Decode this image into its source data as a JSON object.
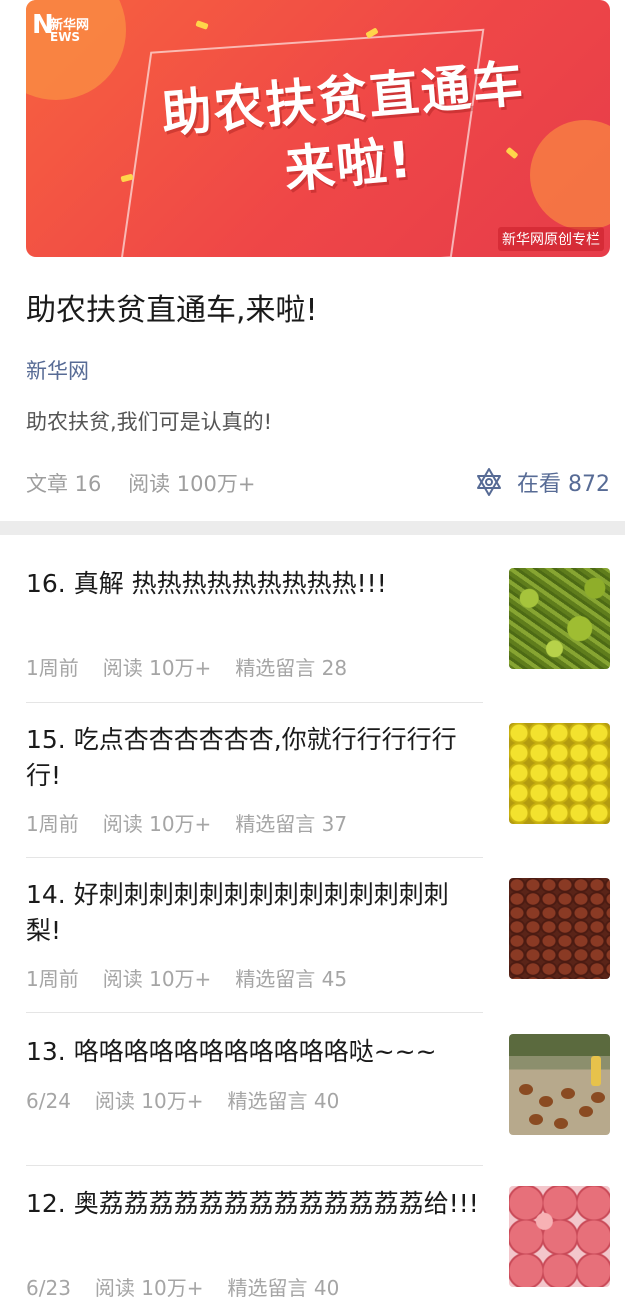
{
  "banner": {
    "logo_text": "新华网",
    "logo_n": "N",
    "logo_ws": "EWS",
    "headline_line1": "助农扶贫直通车",
    "headline_line2": "来啦!",
    "corner_tag": "新华网原创专栏"
  },
  "album": {
    "title": "助农扶贫直通车,来啦!",
    "source": "新华网",
    "description": "助农扶贫,我们可是认真的!",
    "articles_count": "文章 16",
    "reads": "阅读 100万+",
    "watching": "在看 872"
  },
  "articles": [
    {
      "title": "16. 真解 热热热热热热热热热!!!",
      "date": "1周前",
      "reads": "阅读 10万+",
      "comments": "精选留言 28",
      "thumb": "moss-greens"
    },
    {
      "title": "15. 吃点杏杏杏杏杏杏,你就行行行行行行!",
      "date": "1周前",
      "reads": "阅读 10万+",
      "comments": "精选留言 37",
      "thumb": "yellow-apricots"
    },
    {
      "title": "14. 好刺刺刺刺刺刺刺刺刺刺刺刺刺刺梨!",
      "date": "1周前",
      "reads": "阅读 10万+",
      "comments": "精选留言 45",
      "thumb": "dried-prickly-pears"
    },
    {
      "title": "13. 咯咯咯咯咯咯咯咯咯咯咯哒~~~",
      "date": "6/24",
      "reads": "阅读 10万+",
      "comments": "精选留言 40",
      "thumb": "chicken-farm"
    },
    {
      "title": "12. 奥荔荔荔荔荔荔荔荔荔荔荔荔荔给!!!",
      "date": "6/23",
      "reads": "阅读 10万+",
      "comments": "精选留言 40",
      "thumb": "lychees"
    }
  ],
  "colors": {
    "link_blue": "#576b95",
    "meta_gray": "#a5a5a5",
    "banner_red": "#ef4747"
  }
}
